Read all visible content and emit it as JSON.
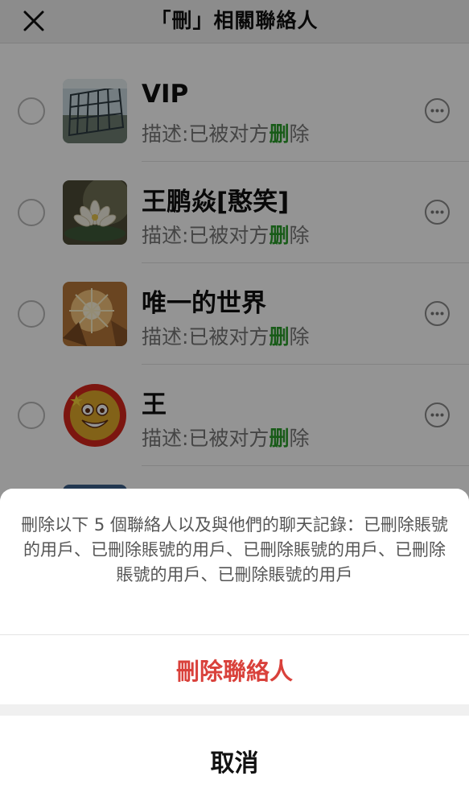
{
  "header": {
    "title": "「刪」相關聯絡人",
    "close_icon": "close-x-icon"
  },
  "contacts": [
    {
      "name": "VIP",
      "desc_prefix": "描述:已被对方",
      "desc_highlight": "删",
      "desc_suffix": "除",
      "avatar": "glass-building-photo"
    },
    {
      "name": "王鹏焱[憨笑]",
      "desc_prefix": "描述:已被对方",
      "desc_highlight": "删",
      "desc_suffix": "除",
      "avatar": "lotus-flower-photo"
    },
    {
      "name": "唯一的世界",
      "desc_prefix": "描述:已被对方",
      "desc_highlight": "删",
      "desc_suffix": "除",
      "avatar": "sun-through-trees-photo"
    },
    {
      "name": "王",
      "desc_prefix": "描述:已被对方",
      "desc_highlight": "删",
      "desc_suffix": "除",
      "avatar": "smiley-flag-face"
    }
  ],
  "colors": {
    "highlight_green": "#2a9d2a",
    "delete_red": "#d9413b"
  },
  "sheet": {
    "message": "刪除以下 5 個聯絡人以及與他們的聊天記錄：已刪除賬號的用戶、已刪除賬號的用戶、已刪除賬號的用戶、已刪除賬號的用戶、已刪除賬號的用戶",
    "delete_label": "刪除聯絡人",
    "cancel_label": "取消"
  }
}
